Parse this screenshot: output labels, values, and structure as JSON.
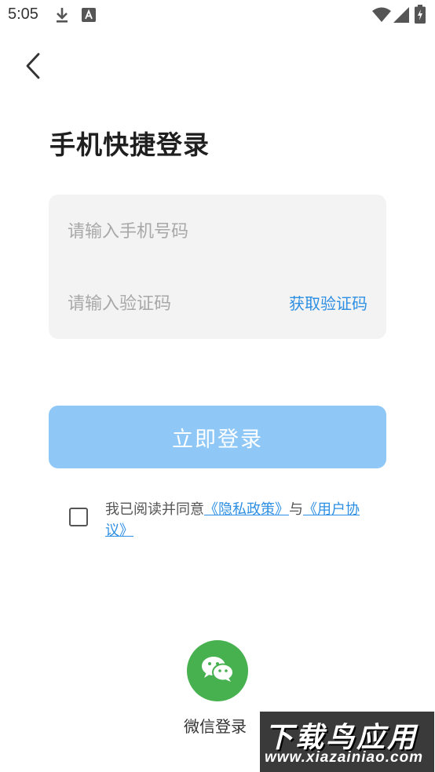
{
  "status_bar": {
    "time": "5:05",
    "left_icons": [
      "download-icon",
      "text-a-icon"
    ],
    "right_icons": [
      "wifi-icon",
      "cellular-signal-icon",
      "battery-icon"
    ]
  },
  "nav": {
    "back_icon": "chevron-left-icon"
  },
  "page": {
    "title": "手机快捷登录"
  },
  "form": {
    "phone_placeholder": "请输入手机号码",
    "phone_value": "",
    "code_placeholder": "请输入验证码",
    "code_value": "",
    "get_code_label": "获取验证码"
  },
  "login_button": {
    "label": "立即登录"
  },
  "agreement": {
    "checked": false,
    "prefix": "我已阅读并同意",
    "privacy_link": "《隐私政策》",
    "connector": "与",
    "terms_link": "《用户协议》"
  },
  "wechat": {
    "label": "微信登录",
    "icon": "wechat-icon"
  },
  "watermark": {
    "line1": "下载鸟应用",
    "line2": "www.xiazainiao.com"
  },
  "colors": {
    "accent": "#2d8fe3",
    "login_button": "#8fc8f7",
    "wechat": "#47b150",
    "card_bg": "#f3f3f3"
  }
}
